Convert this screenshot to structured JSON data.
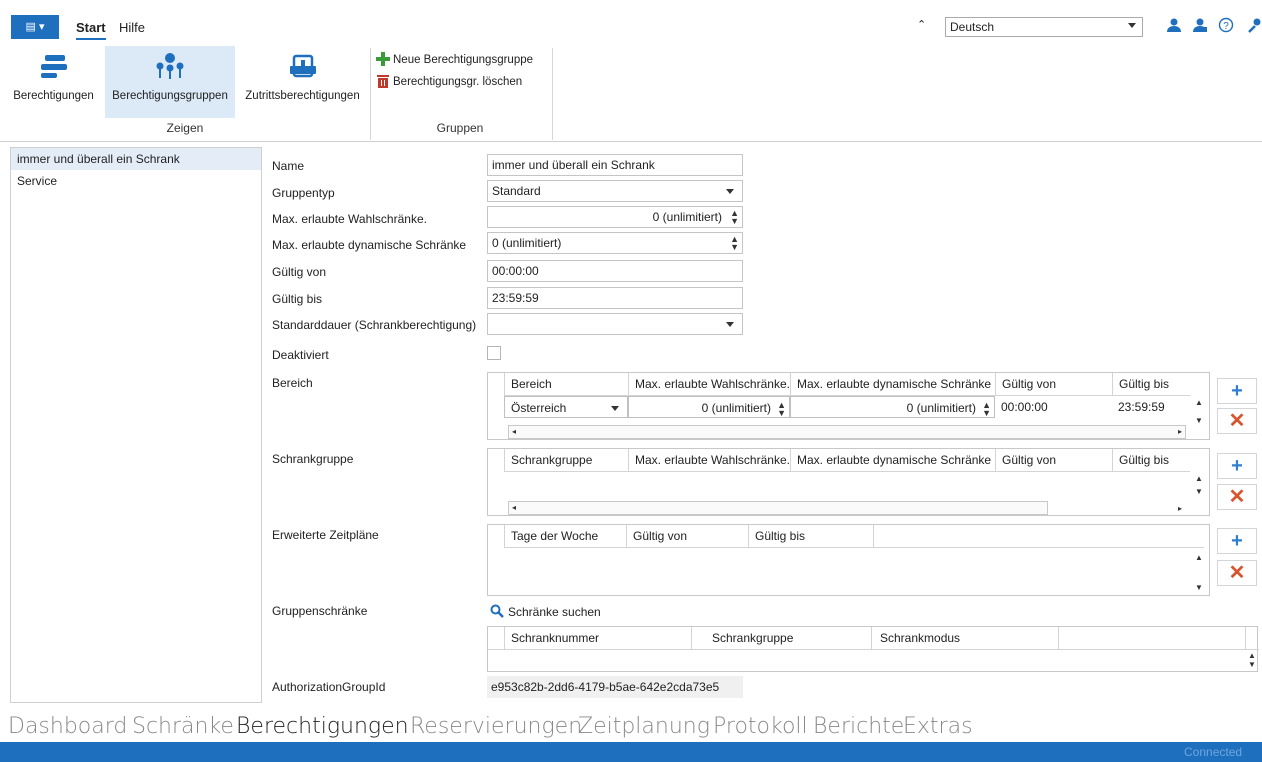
{
  "ribbon": {
    "tabs": [
      "Start",
      "Hilfe"
    ],
    "language": "Deutsch",
    "buttons": [
      "Berechtigungen",
      "Berechtigungsgruppen",
      "Zutrittsberechtigungen"
    ],
    "small_buttons": [
      "Neue Berechtigungsgruppe",
      "Berechtigungsgr. löschen"
    ],
    "groups": [
      "Zeigen",
      "Gruppen"
    ]
  },
  "list": {
    "items": [
      "immer und überall ein Schrank",
      "Service"
    ]
  },
  "form": {
    "labels": {
      "name": "Name",
      "type": "Gruppentyp",
      "maxwahl": "Max. erlaubte Wahlschränke.",
      "maxdyn": "Max. erlaubte dynamische Schränke",
      "von": "Gültig von",
      "bis": "Gültig bis",
      "dauer": "Standarddauer (Schrankberechtigung)",
      "deakt": "Deaktiviert",
      "bereich": "Bereich",
      "schrankgruppe": "Schrankgruppe",
      "zeitplaene": "Erweiterte Zeitpläne",
      "gruppenschraenke": "Gruppenschränke",
      "authid": "AuthorizationGroupId"
    },
    "values": {
      "name": "immer und überall ein Schrank",
      "type": "Standard",
      "maxwahl": "0 (unlimitiert)",
      "maxdyn": "0 (unlimitiert)",
      "von": "00:00:00",
      "bis": "23:59:59",
      "dauer": "",
      "authid": "e953c82b-2dd6-4179-b5ae-642e2cda73e5"
    }
  },
  "bereich_grid": {
    "headers": [
      "Bereich",
      "Max. erlaubte Wahlschränke.",
      "Max. erlaubte dynamische Schränke",
      "Gültig von",
      "Gültig bis"
    ],
    "row": [
      "Österreich",
      "0 (unlimitiert)",
      "0 (unlimitiert)",
      "00:00:00",
      "23:59:59"
    ]
  },
  "schrankgruppe_grid": {
    "headers": [
      "Schrankgruppe",
      "Max. erlaubte Wahlschränke.",
      "Max. erlaubte dynamische Schränke",
      "Gültig von",
      "Gültig bis"
    ]
  },
  "zeit_grid": {
    "headers": [
      "Tage der Woche",
      "Gültig von",
      "Gültig bis"
    ]
  },
  "gruppen_grid": {
    "search": "Schränke suchen",
    "headers": [
      "Schranknummer",
      "Schrankgruppe",
      "Schrankmodus"
    ]
  },
  "bottom_nav": [
    "Dashboard",
    "Schränke",
    "Berechtigungen",
    "Reservierungen",
    "Zeitplanung",
    "Protokoll",
    "Berichte",
    "Extras"
  ],
  "status": "Connected"
}
